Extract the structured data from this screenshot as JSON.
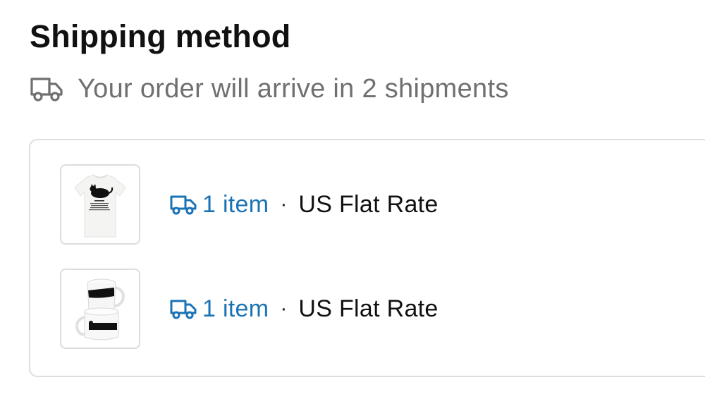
{
  "section": {
    "title": "Shipping method",
    "subtitle": "Your order will arrive in 2 shipments"
  },
  "colors": {
    "link": "#1a73b5",
    "muted": "#707070",
    "border": "#dedede"
  },
  "shipments": [
    {
      "product": "t-shirt",
      "items_label": "1 item",
      "separator": "·",
      "rate": "US Flat Rate",
      "icon": "truck-icon"
    },
    {
      "product": "mug",
      "items_label": "1 item",
      "separator": "·",
      "rate": "US Flat Rate",
      "icon": "truck-icon"
    }
  ]
}
